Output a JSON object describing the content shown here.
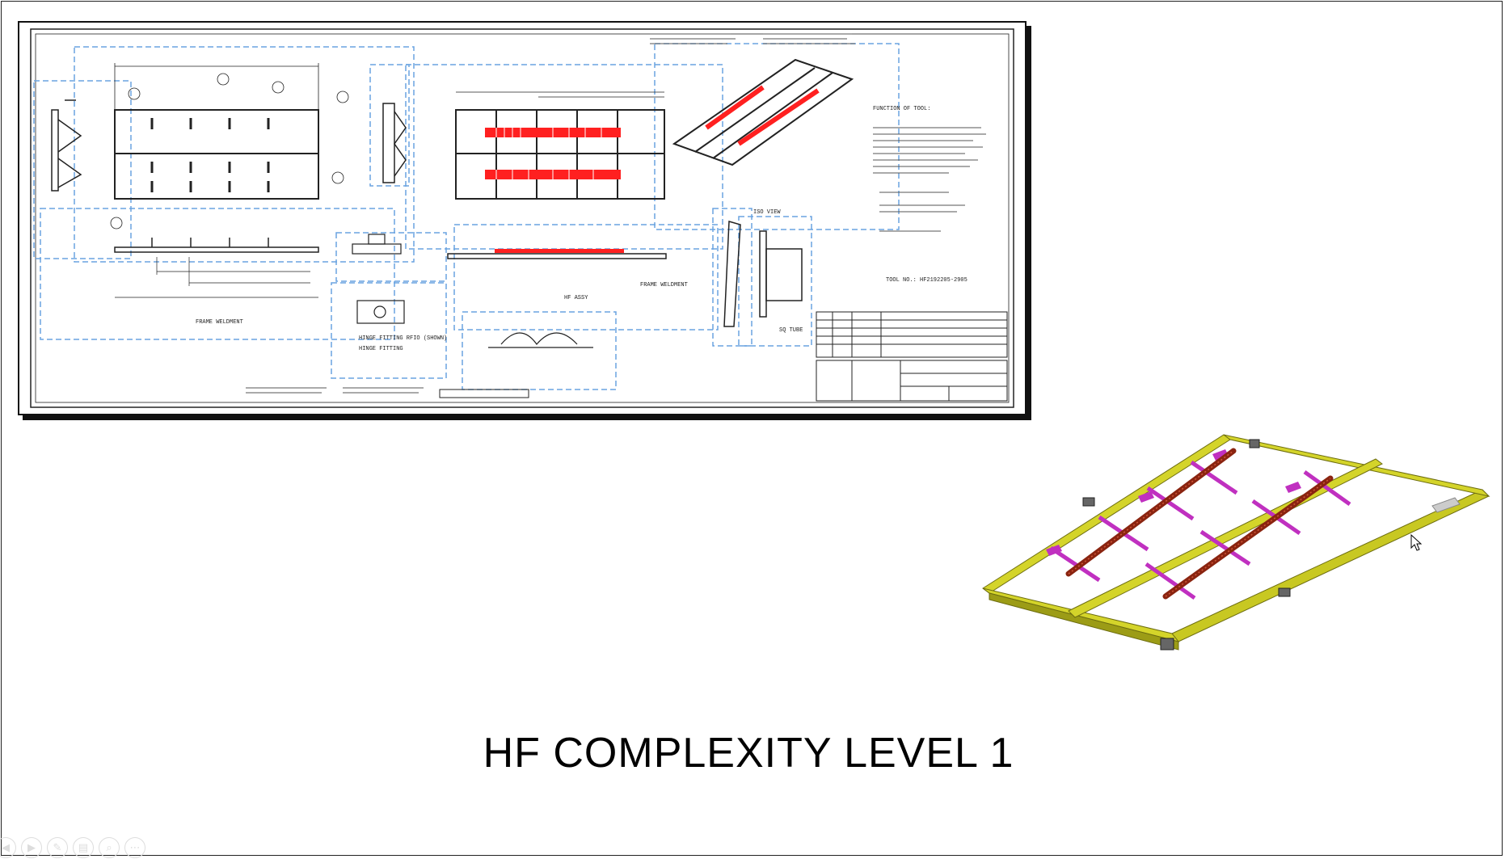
{
  "slide": {
    "title": "HF  COMPLEXITY LEVEL 1"
  },
  "drawing": {
    "labels": {
      "frame_weldment_left": "FRAME WELDMENT",
      "frame_weldment_mid": "FRAME WELDMENT",
      "hinge_fitting_1": "HINGE FITTING RFIO (SHOWN)",
      "hinge_fitting_2": "HINGE FITTING",
      "hf_assy": "HF ASSY",
      "iso_view": "ISO VIEW",
      "detail": "SQ TUBE",
      "function_title": "FUNCTION OF TOOL:",
      "tool_no": "TOOL NO.: HF2192205-2905"
    }
  },
  "toolbar": {
    "buttons": [
      {
        "icon": "previous-icon",
        "glyph": "◀"
      },
      {
        "icon": "next-icon",
        "glyph": "▶"
      },
      {
        "icon": "pen-icon",
        "glyph": "✎"
      },
      {
        "icon": "slides-icon",
        "glyph": "▤"
      },
      {
        "icon": "zoom-icon",
        "glyph": "⌕"
      },
      {
        "icon": "more-icon",
        "glyph": "⋯"
      }
    ]
  },
  "colors": {
    "frame_yellow": "#d4d42a",
    "crossbar_magenta": "#c030c0",
    "pad_red": "#b03018",
    "highlight_red": "#ff2020",
    "view_box_blue": "#6aa3e0"
  }
}
